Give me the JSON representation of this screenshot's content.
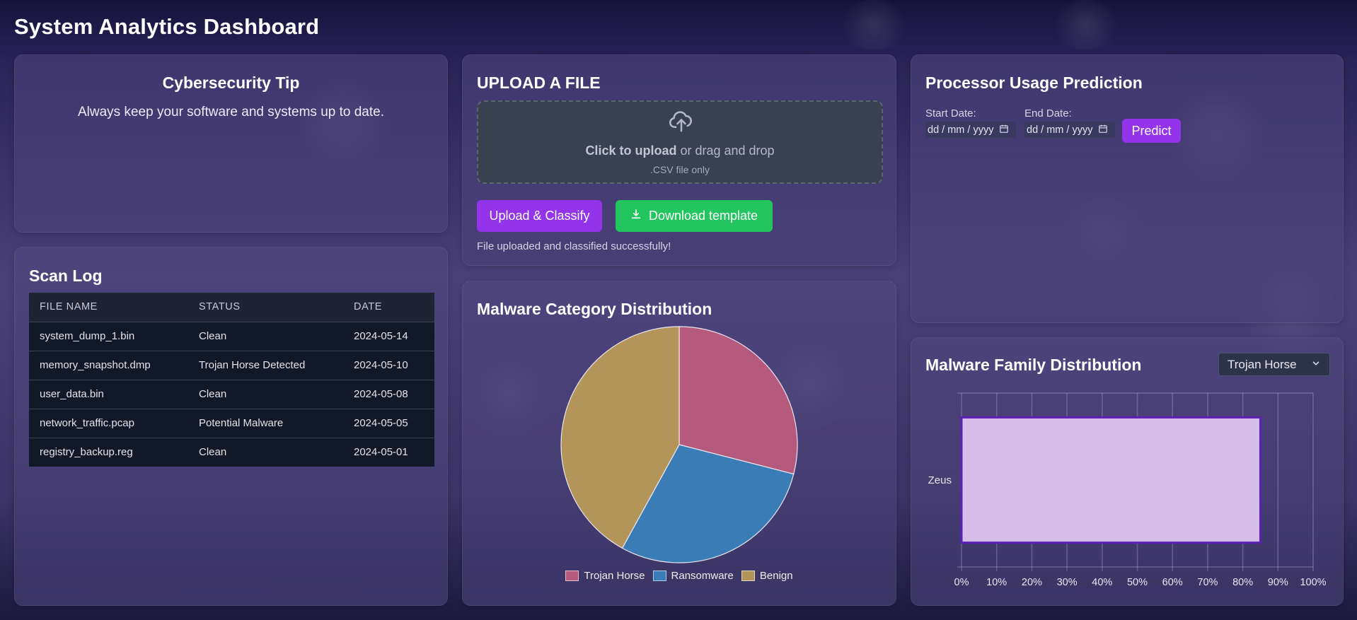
{
  "app": {
    "title": "System Analytics Dashboard"
  },
  "tip": {
    "title": "Cybersecurity Tip",
    "text": "Always keep your software and systems up to date."
  },
  "scan_log": {
    "title": "Scan Log",
    "columns": [
      "FILE NAME",
      "STATUS",
      "DATE"
    ],
    "rows": [
      [
        "system_dump_1.bin",
        "Clean",
        "2024-05-14"
      ],
      [
        "memory_snapshot.dmp",
        "Trojan Horse Detected",
        "2024-05-10"
      ],
      [
        "user_data.bin",
        "Clean",
        "2024-05-08"
      ],
      [
        "network_traffic.pcap",
        "Potential Malware",
        "2024-05-05"
      ],
      [
        "registry_backup.reg",
        "Clean",
        "2024-05-01"
      ]
    ]
  },
  "upload": {
    "title": "UPLOAD A FILE",
    "dropzone_bold": "Click to upload",
    "dropzone_rest": " or drag and drop",
    "dropzone_hint": ".CSV file only",
    "upload_button": "Upload & Classify",
    "download_button": "Download template",
    "status": "File uploaded and classified successfully!",
    "icons": {
      "upload": "cloud-upload-icon",
      "download": "download-icon"
    }
  },
  "processor": {
    "title": "Processor Usage Prediction",
    "start_label": "Start Date:",
    "end_label": "End Date:",
    "start_placeholder": "dd / mm / yyyy",
    "end_placeholder": "dd / mm / yyyy",
    "predict_button": "Predict"
  },
  "family": {
    "title": "Malware Family Distribution",
    "selected": "Trojan Horse"
  },
  "colors": {
    "accent_purple": "#9333ea",
    "accent_green": "#22c55e",
    "trojan": "#b55a7d",
    "ransomware": "#3a7db6",
    "benign": "#b39459",
    "family_bar": "#d4bde6",
    "family_bar_border": "#5b21b6"
  },
  "chart_data": [
    {
      "type": "pie",
      "title": "Malware Category Distribution",
      "categories": [
        "Trojan Horse",
        "Ransomware",
        "Benign"
      ],
      "values": [
        29,
        29,
        42
      ]
    },
    {
      "type": "bar",
      "orientation": "horizontal",
      "title": "Malware Family Distribution",
      "categories": [
        "Zeus"
      ],
      "values": [
        85
      ],
      "xlim": [
        0,
        100
      ],
      "x_ticks": [
        "0%",
        "10%",
        "20%",
        "30%",
        "40%",
        "50%",
        "60%",
        "70%",
        "80%",
        "90%",
        "100%"
      ],
      "grid": true
    }
  ]
}
